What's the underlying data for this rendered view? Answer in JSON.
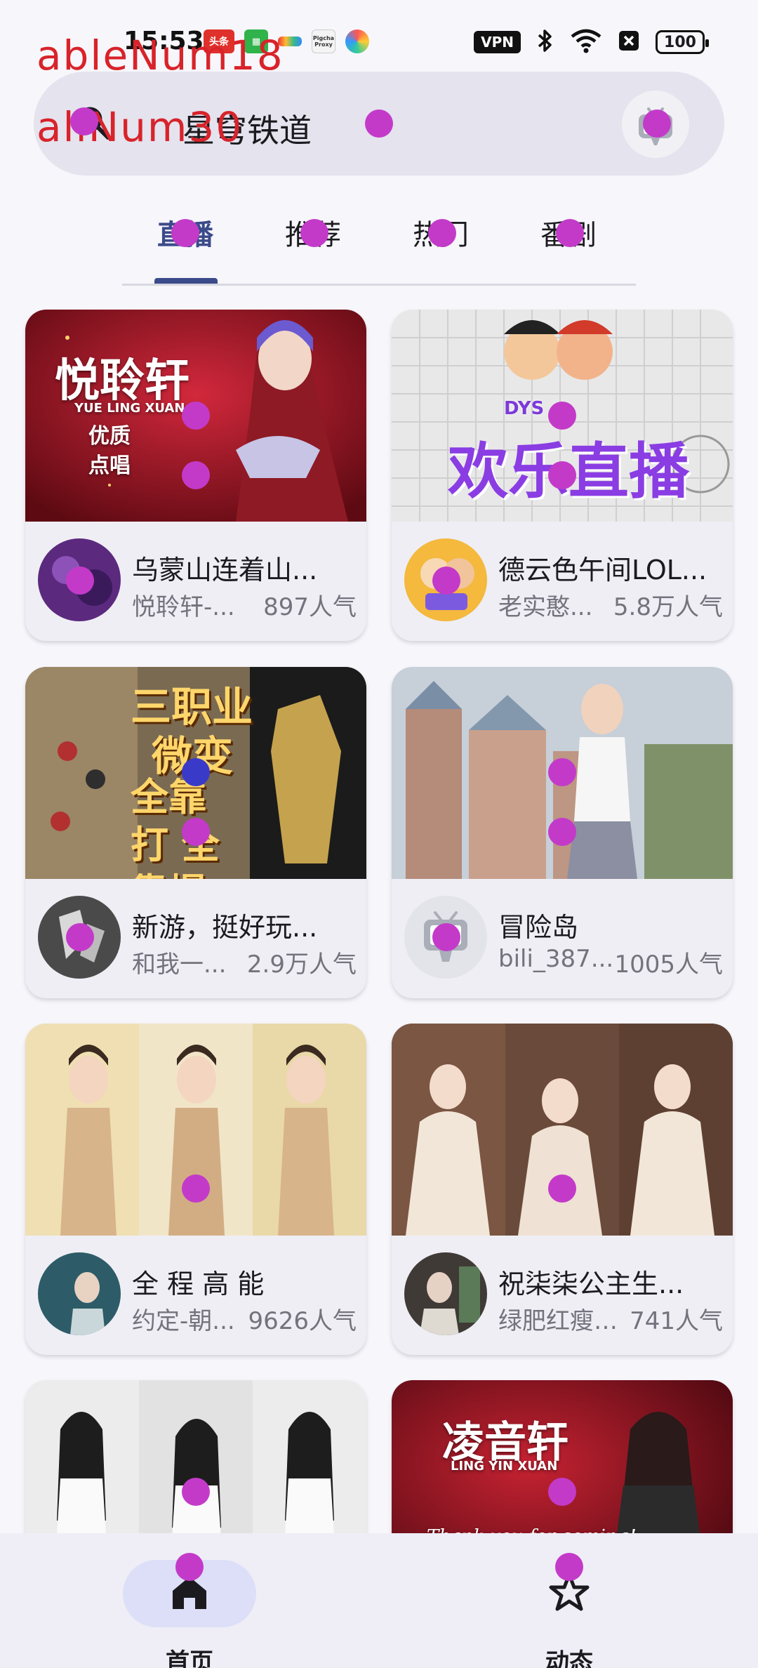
{
  "status_bar": {
    "time": "15:53",
    "vpn": "VPN",
    "battery": "100",
    "app_icons": [
      "头条",
      "",
      "",
      "Pigcha Proxy",
      ""
    ]
  },
  "debug": {
    "line1": "ableNum18",
    "line2": "allNum30"
  },
  "search": {
    "query": "星穹铁道"
  },
  "tabs": [
    {
      "label": "直播",
      "active": true
    },
    {
      "label": "推荐",
      "active": false
    },
    {
      "label": "热门",
      "active": false
    },
    {
      "label": "番剧",
      "active": false
    }
  ],
  "cards": [
    {
      "title": "乌蒙山连着山...",
      "author": "悦聆轩-...",
      "popularity": "897人气",
      "thumb_text": "悦聆轩",
      "thumb_sub": "YUE LING XUAN",
      "thumb_sub2": "优质 点唱"
    },
    {
      "title": "德云色午间LOL...",
      "author": "老实憨...",
      "popularity": "5.8万人气",
      "thumb_text": "欢乐直播",
      "thumb_sub": "DYS",
      "thumb_sub2": ""
    },
    {
      "title": "新游，挺好玩...",
      "author": "和我一...",
      "popularity": "2.9万人气",
      "thumb_text": "三职业",
      "thumb_sub": "微变",
      "thumb_sub2": "全靠打 全靠爆"
    },
    {
      "title": "冒险岛",
      "author": "bili_387...",
      "popularity": "1005人气",
      "thumb_text": "",
      "thumb_sub": "",
      "thumb_sub2": ""
    },
    {
      "title": "全 程 高 能",
      "author": "约定-朝...",
      "popularity": "9626人气",
      "thumb_text": "",
      "thumb_sub": "",
      "thumb_sub2": ""
    },
    {
      "title": "祝柒柒公主生...",
      "author": "绿肥红瘦-...",
      "popularity": "741人气",
      "thumb_text": "",
      "thumb_sub": "",
      "thumb_sub2": ""
    },
    {
      "title": "",
      "author": "",
      "popularity": "",
      "thumb_text": "",
      "thumb_sub": "",
      "thumb_sub2": ""
    },
    {
      "title": "",
      "author": "",
      "popularity": "",
      "thumb_text": "凌音轩",
      "thumb_sub": "LING YIN XUAN",
      "thumb_sub2": "Thank you for coming!"
    }
  ],
  "bottom_nav": [
    {
      "label": "首页",
      "icon": "home-icon",
      "active": true
    },
    {
      "label": "动态",
      "icon": "star-icon",
      "active": false
    }
  ],
  "colors": {
    "accent": "#3b4a8a",
    "marker": "#c33ac9",
    "debug_text": "#d8232a"
  }
}
